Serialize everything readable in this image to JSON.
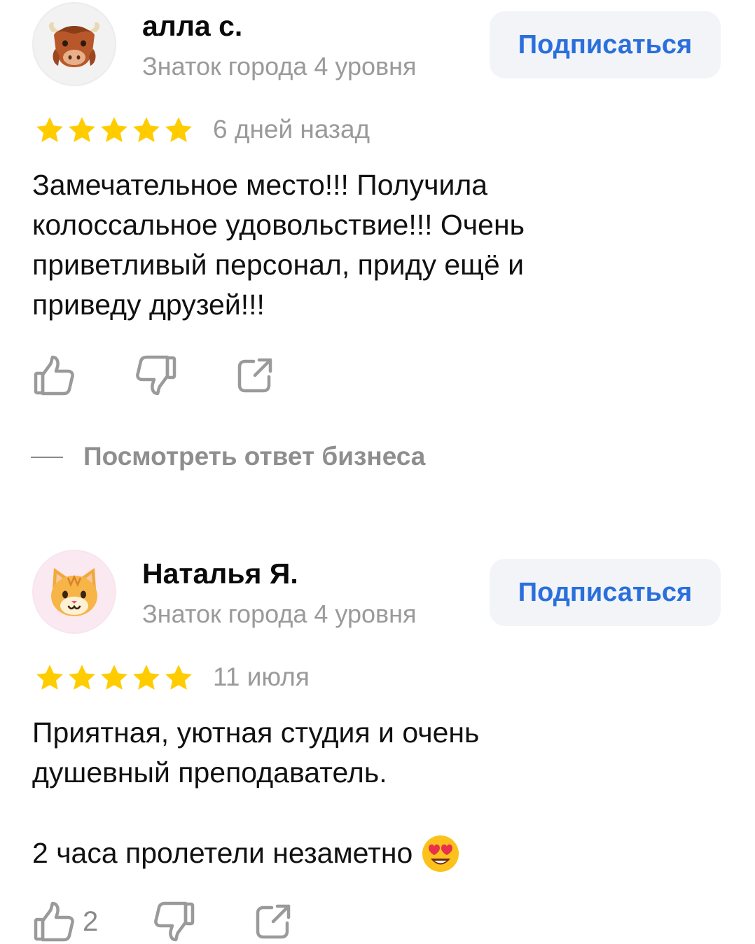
{
  "reviews": [
    {
      "author": "алла с.",
      "level": "Знаток города 4 уровня",
      "subscribe_label": "Подписаться",
      "rating": 5,
      "date": "6 дней назад",
      "text": "Замечательное место!!! Получила\nколоссальное удовольствие!!! Очень\nприветливый персонал, приду ещё и\nприведу друзей!!!",
      "likes": "",
      "business_reply_label": "Посмотреть ответ бизнеса",
      "avatar_icon": "yak-emoji-icon"
    },
    {
      "author": "Наталья Я.",
      "level": "Знаток города 4 уровня",
      "subscribe_label": "Подписаться",
      "rating": 5,
      "date": "11 июля",
      "text_line1": "Приятная, уютная студия и очень\nдушевный преподаватель.",
      "text_line2": "2 часа пролетели незаметно",
      "likes": "2",
      "avatar_icon": "cat-emoji-icon"
    }
  ],
  "colors": {
    "accent": "#2a6fdc",
    "star": "#ffcc00",
    "muted": "#9a9a9a"
  }
}
